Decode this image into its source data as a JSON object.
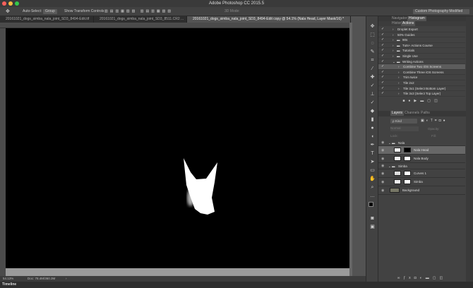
{
  "app_title": "Adobe Photoshop CC 2015.5",
  "options": {
    "auto_select": "Auto-Select:",
    "auto_select_value": "Group",
    "show_transform": "Show Transform Controls",
    "mode_3d": "3D Mode:",
    "workspace": "Custom Photography Modified"
  },
  "tabs": [
    {
      "label": "20161021_dogs_simba_nala_joint_SD3_8494-Edit.tif",
      "active": false
    },
    {
      "label": "20161021_dogs_simba_nala_joint_SD3_8511.CR2 ...",
      "active": false
    },
    {
      "label": "20161021_dogs_simba_nala_joint_SD3_8494-Edit copy @ 54.1% (Nala Head, Layer Mask/16) *",
      "active": true
    }
  ],
  "status": {
    "zoom": "54.13%",
    "doc": "Doc: 78.4M/360.3M"
  },
  "timeline": "Timeline",
  "top_panel": {
    "tabs": [
      "Navigator",
      "Histogram"
    ],
    "sub_tabs": [
      "History",
      "Actions"
    ]
  },
  "actions": [
    {
      "label": "Droplet Export",
      "level": 0,
      "folder": false
    },
    {
      "label": "50% Guides",
      "level": 0,
      "folder": false
    },
    {
      "label": "90s",
      "level": 0,
      "folder": true
    },
    {
      "label": "Tuts+ Actions Course",
      "level": 0,
      "folder": true
    },
    {
      "label": "Tutorials",
      "level": 0,
      "folder": true
    },
    {
      "label": "Single Use",
      "level": 0,
      "folder": true
    },
    {
      "label": "Writing Actions",
      "level": 0,
      "folder": true,
      "open": true
    },
    {
      "label": "Combine Two iOS Screens",
      "level": 1,
      "folder": false,
      "selected": true
    },
    {
      "label": "Combine Three iOS Screens",
      "level": 1,
      "folder": false
    },
    {
      "label": "Trim twice",
      "level": 1,
      "folder": false
    },
    {
      "label": "Tile 2x2",
      "level": 1,
      "folder": false
    },
    {
      "label": "Tile 3x1 (Select Bottom Layer)",
      "level": 1,
      "folder": false
    },
    {
      "label": "Tile 3x3 (Select Top Layer)",
      "level": 1,
      "folder": false
    }
  ],
  "layers_panel": {
    "tabs": [
      "Layers",
      "Channels",
      "Paths"
    ],
    "filter": "Kind",
    "blend": "Normal",
    "opacity_label": "Opacity:",
    "lock_label": "Lock:",
    "fill_label": "Fill:"
  },
  "layers": [
    {
      "label": "Nala",
      "type": "group"
    },
    {
      "label": "Nala Head",
      "type": "layer",
      "selected": true
    },
    {
      "label": "Nala Body",
      "type": "layer"
    },
    {
      "label": "Simba",
      "type": "group"
    },
    {
      "label": "Curves 1",
      "type": "adjustment"
    },
    {
      "label": "Simba",
      "type": "layer"
    },
    {
      "label": "Background",
      "type": "background"
    }
  ],
  "colors": {
    "close": "#fc605c",
    "minimize": "#fdbc40",
    "zoom": "#34c84a",
    "canvas": "#000000",
    "panel": "#424242"
  }
}
